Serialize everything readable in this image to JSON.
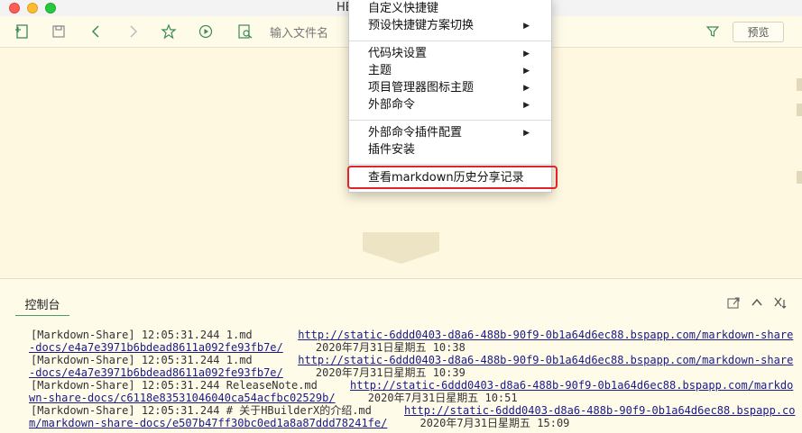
{
  "window": {
    "title": "HB"
  },
  "toolbar": {
    "file_search_placeholder": "输入文件名",
    "preview_label": "预览"
  },
  "menu": {
    "items": [
      {
        "label": "自定义快捷键",
        "submenu": false
      },
      {
        "label": "预设快捷键方案切换",
        "submenu": true
      },
      {
        "label": "代码块设置",
        "submenu": true
      },
      {
        "label": "主题",
        "submenu": true
      },
      {
        "label": "项目管理器图标主题",
        "submenu": true
      },
      {
        "label": "外部命令",
        "submenu": true
      },
      {
        "label": "外部命令插件配置",
        "submenu": true
      },
      {
        "label": "插件安装",
        "submenu": false
      },
      {
        "label": "查看markdown历史分享记录",
        "submenu": false
      }
    ],
    "arrow": "▶"
  },
  "console": {
    "tab_label": "控制台",
    "logs": [
      {
        "line1": "[Markdown-Share] 12:05:31.244 1.md       ",
        "url1": "http://static-6ddd0403-d8a6-488b-90f9-0b1a64d6ec88.bspapp.com/markdown-share",
        "url2": "-docs/e4a7e3971b6bdead8611a092fe93fb7e/",
        "date": "2020年7月31日星期五 10:38"
      },
      {
        "line1": "[Markdown-Share] 12:05:31.244 1.md       ",
        "url1": "http://static-6ddd0403-d8a6-488b-90f9-0b1a64d6ec88.bspapp.com/markdown-share",
        "url2": "-docs/e4a7e3971b6bdead8611a092fe93fb7e/",
        "date": "2020年7月31日星期五 10:39"
      },
      {
        "line1": "[Markdown-Share] 12:05:31.244 ReleaseNote.md     ",
        "url1": "http://static-6ddd0403-d8a6-488b-90f9-0b1a64d6ec88.bspapp.com/markdo",
        "url2": "wn-share-docs/c6118e83531046040ca54acfbc02529b/",
        "date": "2020年7月31日星期五 10:51"
      },
      {
        "line1": "[Markdown-Share] 12:05:31.244 # 关于HBuilderX的介绍.md     ",
        "url1": "http://static-6ddd0403-d8a6-488b-90f9-0b1a64d6ec88.bspapp.co",
        "url2": "m/markdown-share-docs/e507b47ff30bc0ed1a8a87ddd78241fe/",
        "date": "2020年7月31日星期五 15:09"
      }
    ]
  },
  "colors": {
    "highlight": "#e2232a",
    "accent": "#4a9c6a"
  }
}
